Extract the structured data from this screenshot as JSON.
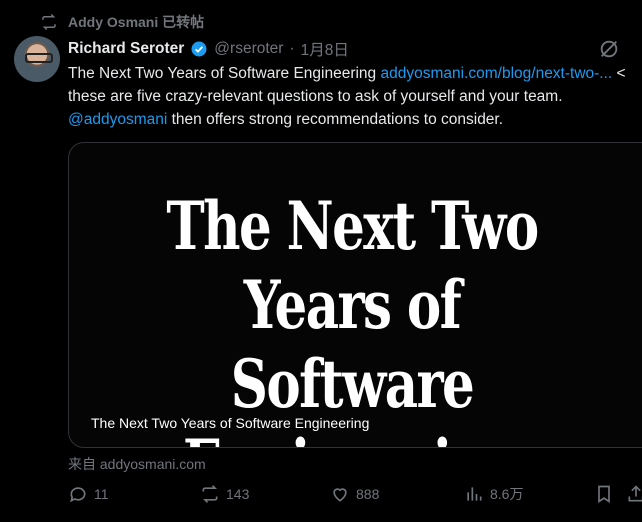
{
  "retweet": {
    "icon": "retweet-icon",
    "label": "Addy Osmani 已转帖"
  },
  "author": {
    "name": "Richard Seroter",
    "handle": "@rseroter",
    "separator": "·",
    "date": "1月8日",
    "verified_color": "#1d9bf0"
  },
  "tweet": {
    "text_1": "The Next Two Years of Software Engineering ",
    "link": "addyosmani.com/blog/next-two-...",
    "text_2": " < these are five crazy-relevant questions to ask of yourself and your team. ",
    "mention": "@addyosmani",
    "text_3": " then offers strong recommendations to consider."
  },
  "card": {
    "image_title_line1": "The Next Two Years of",
    "image_title_line2": "Software Engineering",
    "caption": "The Next Two Years of Software Engineering"
  },
  "source": "来自 addyosmani.com",
  "actions": {
    "replies": "11",
    "reposts": "143",
    "likes": "888",
    "views": "8.6万"
  },
  "colors": {
    "background": "#000000",
    "text": "#e7e9ea",
    "muted": "#71767b",
    "link": "#1d9bf0"
  }
}
